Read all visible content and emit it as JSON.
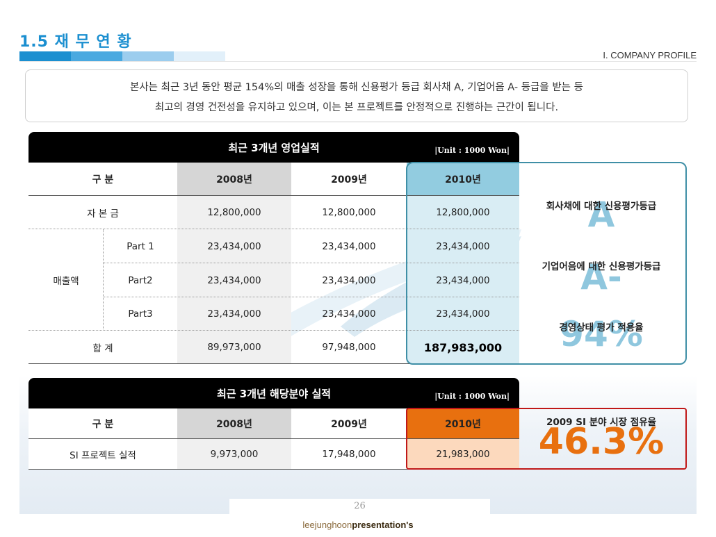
{
  "header": {
    "section_title": "1.5 재 무 연 황",
    "category": "I. COMPANY PROFILE",
    "bar_colors": [
      "#1b8fd0",
      "#4aa9e0",
      "#9ccdee",
      "#e2f0fa"
    ]
  },
  "summary": {
    "line1": "본사는 최근 3년 동안 평균 154%의 매출 성장을 통해 신용평가 등급 회사채 A, 기업어음 A- 등급을 받는 등",
    "line2": "최고의 경영 건전성을 유지하고 있으며, 이는 본 프로젝트를 안정적으로 진행하는 근간이 됩니다."
  },
  "table1": {
    "title": "최근 3개년 영업실적",
    "unit": "|Unit : 1000 Won|",
    "col_label": "구    분",
    "years": [
      "2008년",
      "2009년",
      "2010년"
    ],
    "rows": [
      {
        "label": "자 본 금",
        "values": [
          "12,800,000",
          "12,800,000",
          "12,800,000"
        ]
      },
      {
        "group": "매출액",
        "label": "Part 1",
        "values": [
          "23,434,000",
          "23,434,000",
          "23,434,000"
        ]
      },
      {
        "group": "매출액",
        "label": "Part2",
        "values": [
          "23,434,000",
          "23,434,000",
          "23,434,000"
        ]
      },
      {
        "group": "매출액",
        "label": "Part3",
        "values": [
          "23,434,000",
          "23,434,000",
          "23,434,000"
        ]
      },
      {
        "label": "합    계",
        "values": [
          "89,973,000",
          "97,948,000",
          "187,983,000"
        ]
      }
    ],
    "group_label": "매출액"
  },
  "ratings": {
    "items": [
      {
        "label": "회사채에 대한 신용평가등급",
        "value": "A"
      },
      {
        "label": "기업어음에 대한 신용평가등급",
        "value": "A-"
      },
      {
        "label": "경영상태 평가 적용율",
        "value": "94%"
      }
    ],
    "accent": "#8fc7de"
  },
  "table2": {
    "title": "최근 3개년 해당분야 실적",
    "unit": "|Unit : 1000 Won|",
    "col_label": "구    분",
    "years": [
      "2008년",
      "2009년",
      "2010년"
    ],
    "row": {
      "label": "SI 프로젝트 실적",
      "values": [
        "9,973,000",
        "17,948,000",
        "21,983,000"
      ]
    }
  },
  "market_share": {
    "label": "2009 SI 분야 시장 점유율",
    "value": "46.3%",
    "color": "#e8700f"
  },
  "page_number": "26",
  "footer": {
    "part1": "leejunghoon",
    "part2": "presentation's"
  }
}
